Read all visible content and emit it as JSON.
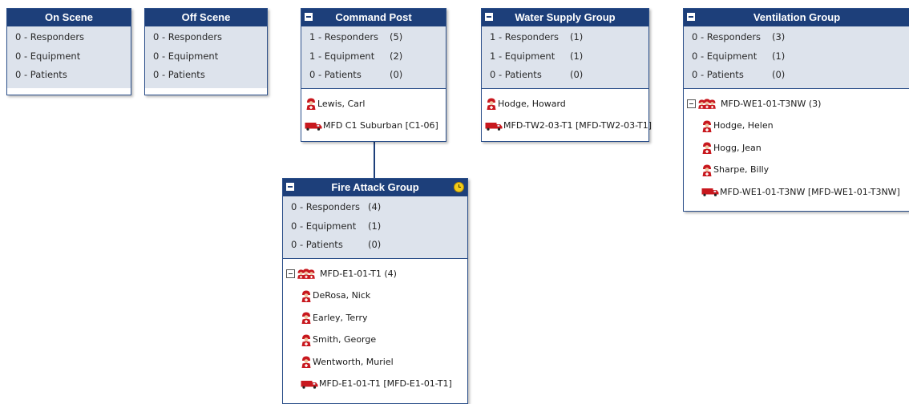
{
  "colors": {
    "header": "#1d3f7a",
    "stats_bg": "#dde3ec",
    "icon_red": "#c8181e"
  },
  "on_scene": {
    "title": "On Scene",
    "stats": [
      {
        "label": "0 - Responders"
      },
      {
        "label": "0 - Equipment"
      },
      {
        "label": "0 - Patients"
      }
    ]
  },
  "off_scene": {
    "title": "Off Scene",
    "stats": [
      {
        "label": "0 - Responders"
      },
      {
        "label": "0 - Equipment"
      },
      {
        "label": "0 - Patients"
      }
    ]
  },
  "command_post": {
    "title": "Command Post",
    "stats": [
      {
        "label": "1 - Responders",
        "count": "(5)"
      },
      {
        "label": "1 - Equipment",
        "count": "(2)"
      },
      {
        "label": "0 - Patients",
        "count": "(0)"
      }
    ],
    "members": [
      {
        "icon": "responder-icon",
        "text": "Lewis, Carl"
      },
      {
        "icon": "truck-icon",
        "text": "MFD C1 Suburban [C1-06]"
      }
    ]
  },
  "water_supply": {
    "title": "Water Supply Group",
    "stats": [
      {
        "label": "1 - Responders",
        "count": "(1)"
      },
      {
        "label": "1 - Equipment",
        "count": "(1)"
      },
      {
        "label": "0 - Patients",
        "count": "(0)"
      }
    ],
    "members": [
      {
        "icon": "responder-icon",
        "text": "Hodge, Howard"
      },
      {
        "icon": "truck-icon",
        "text": "MFD-TW2-03-T1 [MFD-TW2-03-T1]"
      }
    ]
  },
  "ventilation": {
    "title": "Ventilation Group",
    "stats": [
      {
        "label": "0 - Responders",
        "count": "(3)"
      },
      {
        "label": "0 - Equipment",
        "count": "(1)"
      },
      {
        "label": "0 - Patients",
        "count": "(0)"
      }
    ],
    "crew": "MFD-WE1-01-T3NW (3)",
    "members": [
      {
        "icon": "responder-icon",
        "text": "Hodge, Helen"
      },
      {
        "icon": "responder-icon",
        "text": "Hogg, Jean"
      },
      {
        "icon": "responder-icon",
        "text": "Sharpe, Billy"
      },
      {
        "icon": "truck-icon",
        "text": "MFD-WE1-01-T3NW [MFD-WE1-01-T3NW]"
      }
    ]
  },
  "fire_attack": {
    "title": "Fire Attack Group",
    "stats": [
      {
        "label": "0 - Responders",
        "count": "(4)"
      },
      {
        "label": "0 - Equipment",
        "count": "(1)"
      },
      {
        "label": "0 - Patients",
        "count": "(0)"
      }
    ],
    "crew": "MFD-E1-01-T1 (4)",
    "members": [
      {
        "icon": "responder-icon",
        "text": "DeRosa, Nick"
      },
      {
        "icon": "responder-icon",
        "text": "Earley, Terry"
      },
      {
        "icon": "responder-icon",
        "text": "Smith, George"
      },
      {
        "icon": "responder-icon",
        "text": "Wentworth, Muriel"
      },
      {
        "icon": "truck-icon",
        "text": "MFD-E1-01-T1 [MFD-E1-01-T1]"
      }
    ]
  }
}
